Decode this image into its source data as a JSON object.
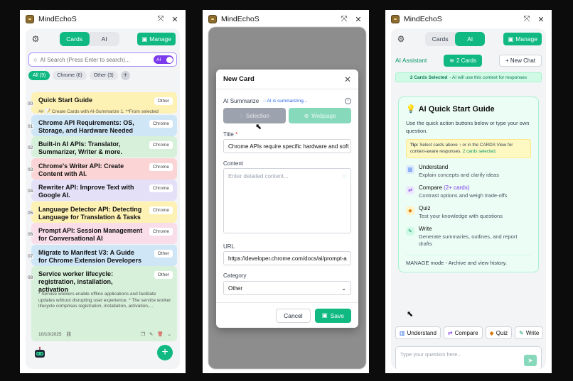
{
  "app": {
    "name": "MindEchoS"
  },
  "tabs": {
    "cards": "Cards",
    "ai": "AI"
  },
  "manage_label": "Manage",
  "search": {
    "placeholder": "AI Search (Press Enter to search)...",
    "ai_badge": "AI"
  },
  "filters": [
    {
      "label": "All",
      "count": "(9)"
    },
    {
      "label": "Chrome",
      "count": "(6)"
    },
    {
      "label": "Other",
      "count": "(3)"
    }
  ],
  "cards": [
    {
      "num": "00",
      "title": "Quick Start Guide",
      "tag": "Other",
      "subtitle": "## 📝 Create Cards with AI-Summarize 1. **From selected",
      "color": "#fdf1b3"
    },
    {
      "num": "01",
      "title": "Chrome API Requirements: OS, Storage, and Hardware Needed",
      "tag": "Chrome",
      "color": "#cfe6f7"
    },
    {
      "num": "02",
      "title": "Built-in AI APIs: Translator, Summarizer, Writer & more.",
      "tag": "Chrome",
      "color": "#d7f0d9"
    },
    {
      "num": "03",
      "title": "Chrome's Writer API: Create Content with AI.",
      "tag": "Chrome",
      "color": "#fbd5d5"
    },
    {
      "num": "04",
      "title": "Rewriter API: Improve Text with Google AI.",
      "tag": "Chrome",
      "color": "#e3e0f7"
    },
    {
      "num": "05",
      "title": "Language Detector API: Detecting Language for Translation & Tasks",
      "tag": "Chrome",
      "color": "#fdf1b3"
    },
    {
      "num": "06",
      "title": "Prompt API: Session Management for Conversational AI",
      "tag": "Chrome",
      "color": "#f9dde9"
    },
    {
      "num": "07",
      "title": "Migrate to Manifest V3: A Guide for Chrome Extension Developers",
      "tag": "Other",
      "color": "#cfe6f7"
    },
    {
      "num": "08",
      "title": "Service worker lifecycle: registration, installation, activation",
      "tag": "Other",
      "color": "#d7f0d9",
      "description": "* Service workers enable offline applications and facilitate updates without disrupting user experience. * The service worker lifecycle comprises registration, installation, activation,...",
      "date": "10/10/2025"
    }
  ],
  "modal": {
    "title": "New Card",
    "ai_summarize": "AI Summarize",
    "ai_busy": "AI is summarizing...",
    "selection": "Selection",
    "webpage": "Webpage",
    "title_label": "Title",
    "title_value": "Chrome APIs require specific hardware and soft",
    "content_label": "Content",
    "content_placeholder": "Enter detailed content...",
    "url_label": "URL",
    "url_value": "https://developer.chrome.com/docs/ai/prompt-a",
    "category_label": "Category",
    "category_value": "Other",
    "cancel": "Cancel",
    "save": "Save"
  },
  "ai_panel": {
    "assistant": "AI Assistant",
    "cards_count": "2 Cards",
    "new_chat": "+ New Chat",
    "selected_bold": "2 Cards Selected",
    "selected_rest": "- AI will use this context for responses",
    "guide_title": "AI Quick Start Guide",
    "guide_desc": "Use the quick action buttons below or type your own question.",
    "tip_bold": "Tip:",
    "tip_text": "Select cards above ↑ or in the CARDS View for context-aware responses.",
    "tip_link": "2 cards selected.",
    "items": [
      {
        "name": "Understand",
        "extra": "",
        "desc": "Explain concepts and clarify ideas"
      },
      {
        "name": "Compare",
        "extra": "(2+ cards)",
        "desc": "Contrast options and weigh trade-offs"
      },
      {
        "name": "Quiz",
        "extra": "",
        "desc": "Test your knowledge with questions"
      },
      {
        "name": "Write",
        "extra": "",
        "desc": "Generate summaries, outlines, and report drafts"
      }
    ],
    "manage_mode": "MANAGE mode - Archive and view history.",
    "quick_actions": [
      "Understand",
      "Compare",
      "Quiz",
      "Write"
    ],
    "question_placeholder": "Type your question here..."
  },
  "colors": {
    "accent": "#10b981",
    "ai_purple": "#7c3aed"
  }
}
